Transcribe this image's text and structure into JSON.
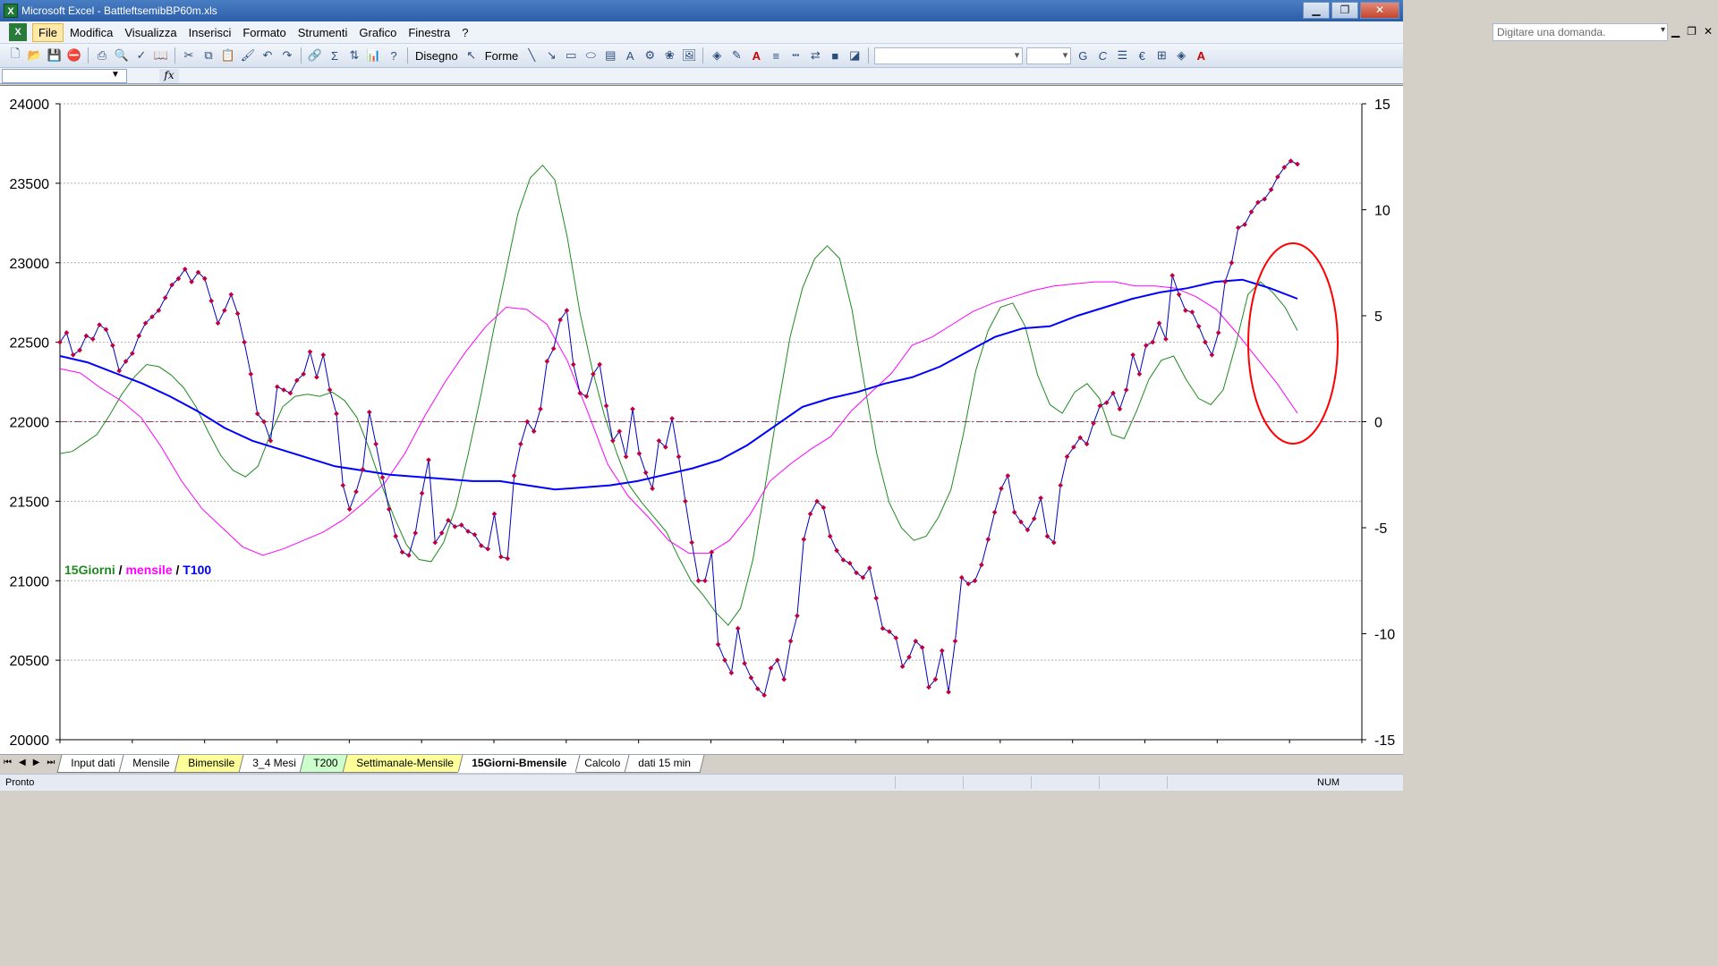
{
  "window": {
    "app_icon": "excel-icon",
    "title": "Microsoft Excel - BattleftsemibBP60m.xls",
    "controls": [
      "minimize-icon",
      "restore-icon",
      "close-icon"
    ]
  },
  "menu": {
    "items": [
      "File",
      "Modifica",
      "Visualizza",
      "Inserisci",
      "Formato",
      "Strumenti",
      "Grafico",
      "Finestra",
      "?"
    ],
    "active": "File",
    "question_placeholder": "Digitare una domanda."
  },
  "toolbar": {
    "drawing_label": "Disegno",
    "shapes_label": "Forme",
    "bold_label": "G",
    "italic_label": "C",
    "euro_label": "€"
  },
  "formula_bar": {
    "fx_label": "fx",
    "name_box": ""
  },
  "chart_data": {
    "type": "line",
    "title": "",
    "legend_text": [
      "15Giorni",
      " / ",
      "mensile",
      " / ",
      "T100"
    ],
    "legend_colors": [
      "#1f8a1f",
      "#000000",
      "#ff00ff",
      "#000000",
      "#0000ff"
    ],
    "left_axis": {
      "min": 20000,
      "max": 24000,
      "ticks": [
        "20000",
        "20500",
        "21000",
        "21500",
        "22000",
        "22500",
        "23000",
        "23500",
        "24000"
      ]
    },
    "right_axis": {
      "min": -15,
      "max": 15,
      "ticks": [
        "-15",
        "-10",
        "-5",
        "0",
        "5",
        "10",
        "15"
      ]
    },
    "zero_line_value": 0,
    "price_series": {
      "color": "#0000c0",
      "marker_color": "#c0003c",
      "y": [
        22500,
        22560,
        22420,
        22450,
        22540,
        22520,
        22610,
        22580,
        22480,
        22320,
        22380,
        22430,
        22540,
        22620,
        22660,
        22700,
        22780,
        22860,
        22900,
        22960,
        22880,
        22940,
        22900,
        22760,
        22620,
        22700,
        22800,
        22680,
        22500,
        22300,
        22050,
        22000,
        21880,
        22220,
        22200,
        22180,
        22260,
        22300,
        22440,
        22280,
        22420,
        22200,
        22050,
        21600,
        21450,
        21560,
        21700,
        22060,
        21860,
        21650,
        21450,
        21280,
        21180,
        21160,
        21300,
        21550,
        21760,
        21240,
        21300,
        21380,
        21340,
        21350,
        21310,
        21290,
        21220,
        21200,
        21420,
        21150,
        21140,
        21660,
        21860,
        22000,
        21940,
        22080,
        22380,
        22460,
        22640,
        22700,
        22360,
        22180,
        22160,
        22300,
        22360,
        22100,
        21880,
        21940,
        21780,
        22080,
        21800,
        21680,
        21580,
        21880,
        21840,
        22020,
        21780,
        21500,
        21240,
        21000,
        21000,
        21180,
        20600,
        20500,
        20420,
        20700,
        20480,
        20390,
        20320,
        20280,
        20450,
        20500,
        20380,
        20620,
        20780,
        21260,
        21420,
        21500,
        21460,
        21280,
        21190,
        21130,
        21110,
        21050,
        21020,
        21080,
        20890,
        20700,
        20680,
        20640,
        20460,
        20520,
        20620,
        20580,
        20330,
        20380,
        20560,
        20300,
        20620,
        21020,
        20980,
        21000,
        21100,
        21260,
        21430,
        21580,
        21660,
        21430,
        21370,
        21320,
        21390,
        21520,
        21280,
        21240,
        21600,
        21780,
        21840,
        21900,
        21860,
        21990,
        22100,
        22120,
        22180,
        22080,
        22200,
        22420,
        22300,
        22480,
        22500,
        22620,
        22520,
        22920,
        22800,
        22700,
        22690,
        22600,
        22500,
        22420,
        22560,
        22880,
        23000,
        23220,
        23240,
        23320,
        23380,
        23400,
        23460,
        23540,
        23600,
        23640,
        23620
      ]
    },
    "series": [
      {
        "name": "15Giorni",
        "color": "#1f8a1f",
        "axis": "right",
        "y": [
          -1.5,
          -1.4,
          -1.0,
          -0.6,
          0.3,
          1.3,
          2.1,
          2.7,
          2.6,
          2.2,
          1.6,
          0.7,
          -0.5,
          -1.6,
          -2.3,
          -2.6,
          -2.1,
          -0.6,
          0.7,
          1.2,
          1.3,
          1.2,
          1.4,
          1.0,
          0.2,
          -1.3,
          -3.0,
          -4.5,
          -5.8,
          -6.5,
          -6.6,
          -5.7,
          -4.0,
          -1.5,
          1.2,
          4.2,
          7.0,
          9.8,
          11.5,
          12.1,
          11.4,
          8.7,
          5.2,
          2.5,
          0.3,
          -1.5,
          -3.0,
          -3.8,
          -4.5,
          -5.2,
          -6.4,
          -7.5,
          -8.2,
          -9.0,
          -9.6,
          -8.8,
          -6.5,
          -3.0,
          0.6,
          4.0,
          6.3,
          7.7,
          8.3,
          7.7,
          5.3,
          1.8,
          -1.5,
          -3.8,
          -5.0,
          -5.6,
          -5.4,
          -4.5,
          -3.2,
          -0.6,
          2.4,
          4.3,
          5.4,
          5.6,
          4.5,
          2.2,
          0.8,
          0.4,
          1.4,
          1.8,
          1.1,
          -0.6,
          -0.8,
          0.5,
          2.0,
          2.9,
          3.1,
          2.0,
          1.1,
          0.8,
          1.5,
          3.6,
          6.0,
          6.6,
          6.1,
          5.4,
          4.3
        ]
      },
      {
        "name": "mensile",
        "color": "#ff00ff",
        "axis": "right",
        "y": [
          2.5,
          2.3,
          1.6,
          1.0,
          0.2,
          -1.2,
          -2.8,
          -4.1,
          -5.0,
          -5.9,
          -6.3,
          -6.0,
          -5.6,
          -5.2,
          -4.6,
          -3.8,
          -2.9,
          -1.5,
          0.3,
          1.9,
          3.3,
          4.5,
          5.4,
          5.3,
          4.6,
          2.9,
          0.5,
          -2.0,
          -3.5,
          -4.5,
          -5.6,
          -6.2,
          -6.2,
          -5.6,
          -4.4,
          -2.8,
          -2.0,
          -1.3,
          -0.7,
          0.5,
          1.4,
          2.3,
          3.6,
          4.0,
          4.6,
          5.2,
          5.6,
          5.9,
          6.2,
          6.4,
          6.5,
          6.6,
          6.6,
          6.4,
          6.4,
          6.3,
          5.9,
          5.3,
          4.2,
          3.0,
          1.8,
          0.4
        ]
      },
      {
        "name": "T100",
        "color": "#0000ff",
        "axis": "right",
        "y": [
          3.1,
          2.8,
          2.3,
          1.8,
          1.2,
          0.5,
          -0.3,
          -0.9,
          -1.3,
          -1.7,
          -2.1,
          -2.3,
          -2.5,
          -2.6,
          -2.7,
          -2.8,
          -2.8,
          -3.0,
          -3.2,
          -3.1,
          -3.0,
          -2.8,
          -2.5,
          -2.2,
          -1.8,
          -1.1,
          -0.2,
          0.7,
          1.1,
          1.4,
          1.8,
          2.1,
          2.6,
          3.3,
          4.0,
          4.4,
          4.5,
          5.0,
          5.4,
          5.8,
          6.1,
          6.3,
          6.6,
          6.7,
          6.3,
          5.8
        ]
      }
    ],
    "annotation": {
      "shape": "ellipse",
      "color": "#ff0000"
    },
    "grid": "horizontal dotted"
  },
  "sheet_tabs": [
    {
      "label": "Input dati",
      "color": "white"
    },
    {
      "label": "Mensile",
      "color": "white"
    },
    {
      "label": "Bimensile",
      "color": "yellow"
    },
    {
      "label": "3_4 Mesi",
      "color": "white"
    },
    {
      "label": "T200",
      "color": "green"
    },
    {
      "label": "Settimanale-Mensile",
      "color": "yellow"
    },
    {
      "label": "15Giorni-Bmensile",
      "color": "active"
    },
    {
      "label": "Calcolo",
      "color": "white"
    },
    {
      "label": "dati 15 min",
      "color": "white"
    }
  ],
  "tab_nav_icons": [
    "first-sheet-icon",
    "prev-sheet-icon",
    "next-sheet-icon",
    "last-sheet-icon"
  ],
  "status": {
    "ready": "Pronto",
    "num": "NUM"
  }
}
